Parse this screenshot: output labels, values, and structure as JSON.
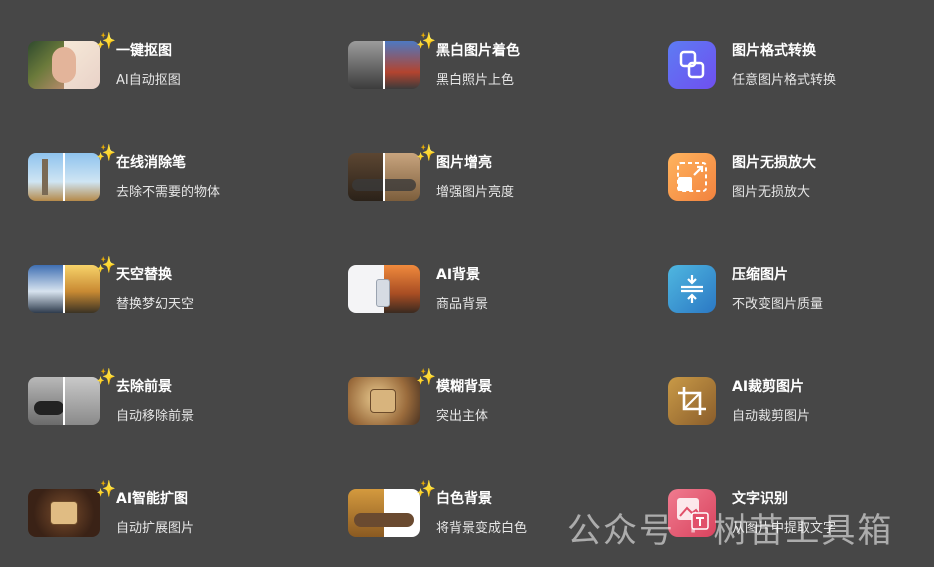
{
  "tools": [
    {
      "title": "一键抠图",
      "desc": "AI自动抠图"
    },
    {
      "title": "黑白图片着色",
      "desc": "黑白照片上色"
    },
    {
      "title": "图片格式转换",
      "desc": "任意图片格式转换"
    },
    {
      "title": "在线消除笔",
      "desc": "去除不需要的物体"
    },
    {
      "title": "图片增亮",
      "desc": "增强图片亮度"
    },
    {
      "title": "图片无损放大",
      "desc": "图片无损放大"
    },
    {
      "title": "天空替换",
      "desc": "替换梦幻天空"
    },
    {
      "title": "AI背景",
      "desc": "商品背景"
    },
    {
      "title": "压缩图片",
      "desc": "不改变图片质量"
    },
    {
      "title": "去除前景",
      "desc": "自动移除前景"
    },
    {
      "title": "模糊背景",
      "desc": "突出主体"
    },
    {
      "title": "AI裁剪图片",
      "desc": "自动裁剪图片"
    },
    {
      "title": "AI智能扩图",
      "desc": "自动扩展图片"
    },
    {
      "title": "白色背景",
      "desc": "将背景变成白色"
    },
    {
      "title": "文字识别",
      "desc": "从图片中提取文字"
    }
  ],
  "sparkle": "✨",
  "watermark": "公众号 · 树苗工具箱"
}
